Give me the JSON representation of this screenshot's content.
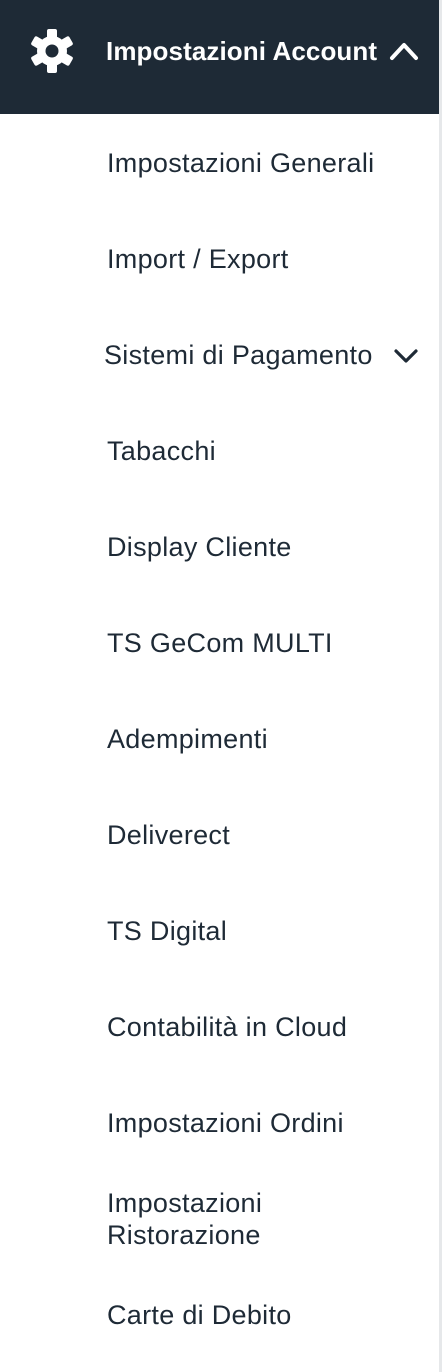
{
  "header": {
    "title": "Impostazioni Account",
    "icon": "gear-icon",
    "toggle_icon": "chevron-up-icon",
    "background": "#1e2a36",
    "text_color": "#ffffff"
  },
  "menu": {
    "text_color": "#1e2a36",
    "items": [
      {
        "label": "Impostazioni Generali"
      },
      {
        "label": "Import / Export"
      },
      {
        "label": "Sistemi di Pagamento",
        "icon": "chevron-down-icon"
      },
      {
        "label": "Tabacchi"
      },
      {
        "label": "Display Cliente"
      },
      {
        "label": "TS GeCom MULTI"
      },
      {
        "label": "Adempimenti"
      },
      {
        "label": "Deliverect"
      },
      {
        "label": "TS Digital"
      },
      {
        "label": "Contabilità in Cloud"
      },
      {
        "label": "Impostazioni Ordini"
      },
      {
        "label": "Impostazioni Ristorazione"
      },
      {
        "label": "Carte di Debito"
      }
    ]
  }
}
